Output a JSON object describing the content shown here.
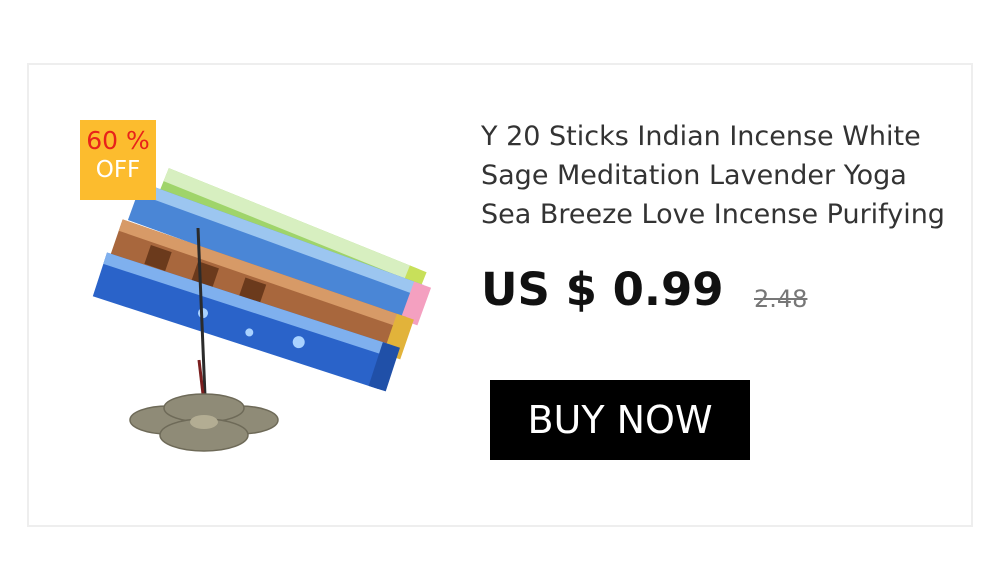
{
  "product": {
    "title": "Y 20 Sticks Indian Incense White Sage Meditation Lavender Yoga Sea Breeze Love Incense Purifying",
    "price": "US $ 0.99",
    "old_price": "2.48",
    "image_icon": "incense-sticks-and-lotus-holder-image"
  },
  "badge": {
    "percent": "60 %",
    "off": "OFF",
    "bg_color": "#fcbc2e",
    "percent_color": "#e8231a"
  },
  "buy_button": {
    "label": "BUY NOW",
    "bg_color": "#000000"
  }
}
